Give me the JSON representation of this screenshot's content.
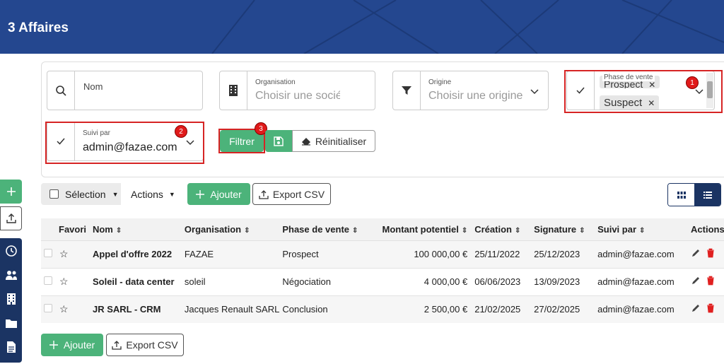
{
  "header": {
    "title": "3 Affaires"
  },
  "filters": {
    "nom": {
      "placeholder": "Nom"
    },
    "organisation": {
      "label": "Organisation",
      "placeholder": "Choisir une socié"
    },
    "origine": {
      "label": "Origine",
      "placeholder": "Choisir une origine"
    },
    "phase": {
      "label": "Phase de vente",
      "chips": [
        "Prospect",
        "Suspect"
      ]
    },
    "suivi": {
      "label": "Suivi par",
      "value": "admin@fazae.com"
    },
    "filtrer_label": "Filtrer",
    "reinit_label": "Réinitialiser"
  },
  "badges": [
    "1",
    "2",
    "3"
  ],
  "toolbar": {
    "selection_label": "Sélection",
    "actions_label": "Actions",
    "add_label": "Ajouter",
    "export_label": "Export CSV"
  },
  "table": {
    "headers": [
      "Favori",
      "Nom",
      "Organisation",
      "Phase de vente",
      "Montant potentiel",
      "Création",
      "Signature",
      "Suivi par",
      "Actions"
    ],
    "rows": [
      {
        "nom": "Appel d'offre 2022",
        "organisation": "FAZAE",
        "phase": "Prospect",
        "montant": "100 000,00 €",
        "creation": "25/11/2022",
        "signature": "25/12/2023",
        "suivi": "admin@fazae.com"
      },
      {
        "nom": "Soleil - data center",
        "organisation": "soleil",
        "phase": "Négociation",
        "montant": "4 000,00 €",
        "creation": "06/06/2023",
        "signature": "13/09/2023",
        "suivi": "admin@fazae.com"
      },
      {
        "nom": "JR SARL - CRM",
        "organisation": "Jacques Renault SARL",
        "phase": "Conclusion",
        "montant": "2 500,00 €",
        "creation": "21/02/2025",
        "signature": "27/02/2025",
        "suivi": "admin@fazae.com"
      }
    ]
  },
  "footer": {
    "add_label": "Ajouter",
    "export_label": "Export CSV"
  },
  "colors": {
    "header": "#24478f",
    "green": "#4cb37a",
    "nav": "#1b3463",
    "red_annotation": "#d62424"
  }
}
